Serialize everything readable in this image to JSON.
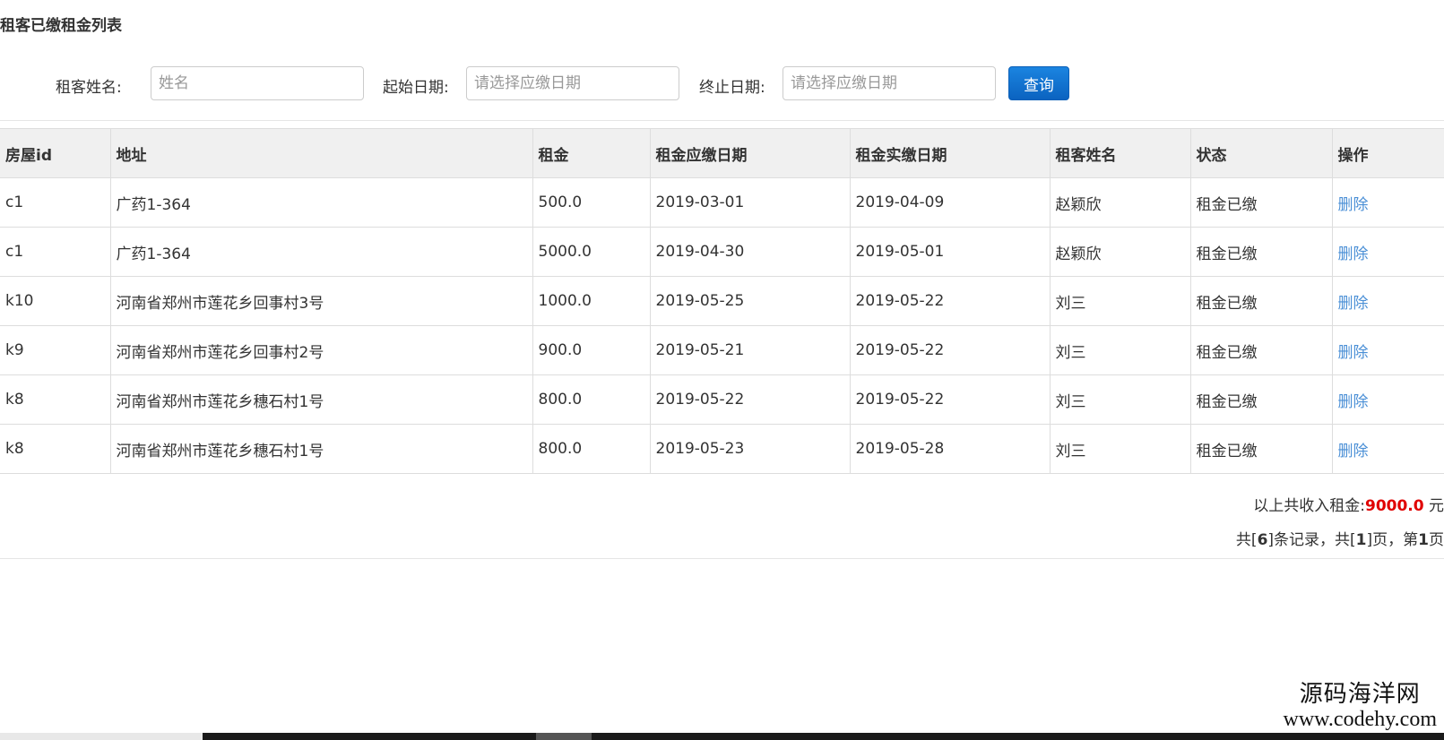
{
  "page": {
    "title": "租客已缴租金列表"
  },
  "filters": {
    "tenant_name_label": "租客姓名:",
    "tenant_name_placeholder": "姓名",
    "start_date_label": "起始日期:",
    "start_date_placeholder": "请选择应缴日期",
    "end_date_label": "终止日期:",
    "end_date_placeholder": "请选择应缴日期",
    "query_button": "查询"
  },
  "table": {
    "headers": [
      "房屋id",
      "地址",
      "租金",
      "租金应缴日期",
      "租金实缴日期",
      "租客姓名",
      "状态",
      "操作"
    ],
    "rows": [
      {
        "house_id": "c1",
        "address": "广药1-364",
        "rent": "500.0",
        "due_date": "2019-03-01",
        "paid_date": "2019-04-09",
        "tenant": "赵颖欣",
        "status": "租金已缴",
        "action": "删除"
      },
      {
        "house_id": "c1",
        "address": "广药1-364",
        "rent": "5000.0",
        "due_date": "2019-04-30",
        "paid_date": "2019-05-01",
        "tenant": "赵颖欣",
        "status": "租金已缴",
        "action": "删除"
      },
      {
        "house_id": "k10",
        "address": "河南省郑州市莲花乡回事村3号",
        "rent": "1000.0",
        "due_date": "2019-05-25",
        "paid_date": "2019-05-22",
        "tenant": "刘三",
        "status": "租金已缴",
        "action": "删除"
      },
      {
        "house_id": "k9",
        "address": "河南省郑州市莲花乡回事村2号",
        "rent": "900.0",
        "due_date": "2019-05-21",
        "paid_date": "2019-05-22",
        "tenant": "刘三",
        "status": "租金已缴",
        "action": "删除"
      },
      {
        "house_id": "k8",
        "address": "河南省郑州市莲花乡穗石村1号",
        "rent": "800.0",
        "due_date": "2019-05-22",
        "paid_date": "2019-05-22",
        "tenant": "刘三",
        "status": "租金已缴",
        "action": "删除"
      },
      {
        "house_id": "k8",
        "address": "河南省郑州市莲花乡穗石村1号",
        "rent": "800.0",
        "due_date": "2019-05-23",
        "paid_date": "2019-05-28",
        "tenant": "刘三",
        "status": "租金已缴",
        "action": "删除"
      }
    ]
  },
  "summary": {
    "prefix": "以上共收入租金:",
    "total": "9000.0",
    "unit": "元"
  },
  "pagination": {
    "p1": "共[",
    "records": "6",
    "p2": "]条记录，共[",
    "pages": "1",
    "p3": "]页，第",
    "current": "1",
    "p4": "页"
  },
  "watermark": {
    "name": "源码海洋网",
    "url": "www.codehy.com"
  },
  "colors": {
    "button_blue": "#0b63c0",
    "link_blue": "#4a8fd6",
    "total_red": "#e00000",
    "header_bg": "#f0f0f0"
  }
}
